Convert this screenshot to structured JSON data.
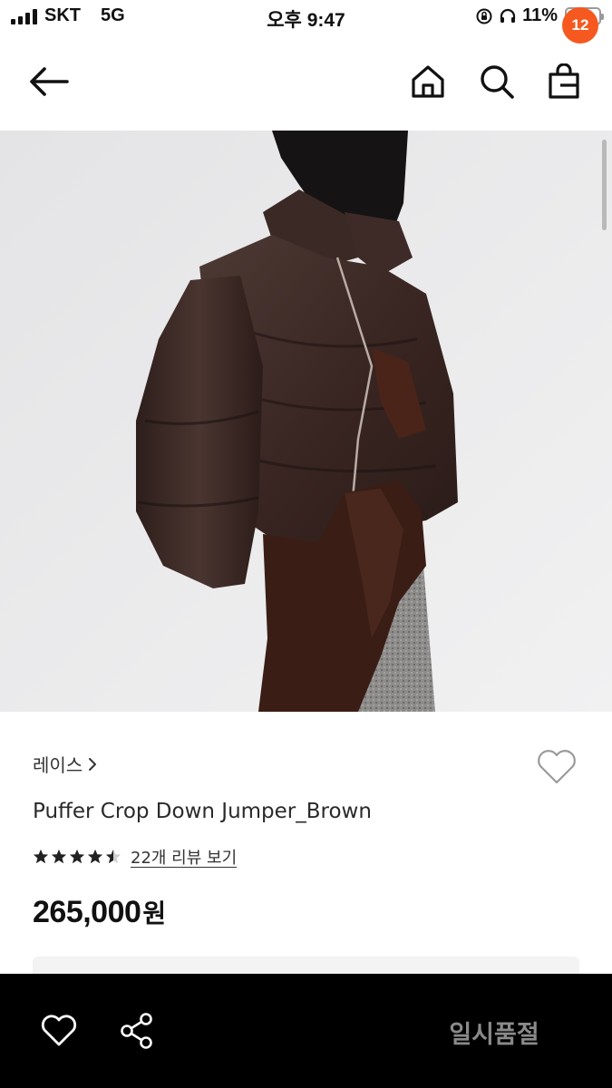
{
  "status_bar": {
    "carrier": "SKT",
    "network": "5G",
    "time": "오후 9:47",
    "battery": "11%",
    "battery_level": 0.11
  },
  "nav": {
    "back_icon": "arrow-left-icon",
    "home_icon": "home-icon",
    "search_icon": "search-icon",
    "cart_icon": "shopping-bag-icon",
    "cart_count": "12",
    "badge_color": "#f5591f"
  },
  "product": {
    "brand": "레이스",
    "brand_chevron": "›",
    "name": "Puffer Crop Down Jumper_Brown",
    "rating": 4.5,
    "review_link": "22개 리뷰 보기",
    "price": "265,000",
    "currency": "원",
    "image_icon": "product-photo"
  },
  "bottom_bar": {
    "wishlist_icon": "heart-icon",
    "share_icon": "share-icon",
    "status_label": "일시품절"
  }
}
